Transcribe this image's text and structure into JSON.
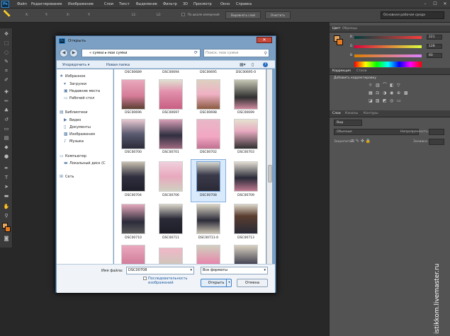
{
  "app": {
    "logo": "Ps",
    "menu": [
      "Файл",
      "Редактирование",
      "Изображение",
      "Слои",
      "Текст",
      "Выделение",
      "Фильтр",
      "3D",
      "Просмотр",
      "Окно",
      "Справка"
    ],
    "window_controls": [
      "–",
      "☐",
      "✕"
    ]
  },
  "options_bar": {
    "items": [
      "X:",
      "Y:",
      "X:",
      "Y:",
      "L1:",
      "L2:"
    ],
    "checkbox_label": "По шкале измерений",
    "btn1": "Выровнять слой",
    "btn2": "Очистить",
    "workspace": "Основная рабочая среда"
  },
  "panels": {
    "color_tabs": [
      "Цвет",
      "Образцы"
    ],
    "sliders": [
      {
        "label": "R",
        "value": "221"
      },
      {
        "label": "G",
        "value": "128"
      },
      {
        "label": "B",
        "value": "60"
      }
    ],
    "adj_tabs": [
      "Коррекция",
      "Стили"
    ],
    "adj_title": "Добавить корректировку",
    "layers_tabs": [
      "Слои",
      "Каналы",
      "Контуры"
    ],
    "layers_filter": "Вид",
    "blend_mode": "Обычные",
    "opacity_label": "Непрозрачность:",
    "lock_label": "Закрепить:",
    "fill_label": "Заливка:"
  },
  "dialog": {
    "title": "Открыть",
    "address": "« сумки ▸ мои сумки",
    "search_placeholder": "Поиск: мои сумки",
    "cmd": {
      "organize": "Упорядочить ▾",
      "new_folder": "Новая папка"
    },
    "nav": {
      "favorites": "Избранное",
      "downloads": "Загрузки",
      "recent": "Недавние места",
      "desktop": "Рабочий стол",
      "libraries": "Библиотеки",
      "video": "Видео",
      "documents": "Документы",
      "images": "Изображения",
      "music": "Музыка",
      "computer": "Компьютер",
      "local_disk": "Локальный диск (C",
      "network": "Сеть"
    },
    "top_row": [
      "DSC00689",
      "DSC00694",
      "DSC00695",
      "DSC00695-0"
    ],
    "files": [
      [
        "DSC00696",
        "DSC00697",
        "DSC00698",
        "DSC00699"
      ],
      [
        "DSC00700",
        "DSC00701",
        "DSC00702",
        "DSC00703"
      ],
      [
        "DSC00704",
        "DSC00706",
        "DSC00708",
        "DSC00709"
      ],
      [
        "DSC00710",
        "DSC00711",
        "DSC00711-0",
        "DSC00713"
      ]
    ],
    "filename_label": "Имя файла:",
    "filename": "DSC00708",
    "format": "Все форматы",
    "preview_label1": "Последовательность",
    "preview_label2": "изображений",
    "open": "Открыть",
    "cancel": "Отмена"
  },
  "watermark": "istikkom.livemaster.ru"
}
